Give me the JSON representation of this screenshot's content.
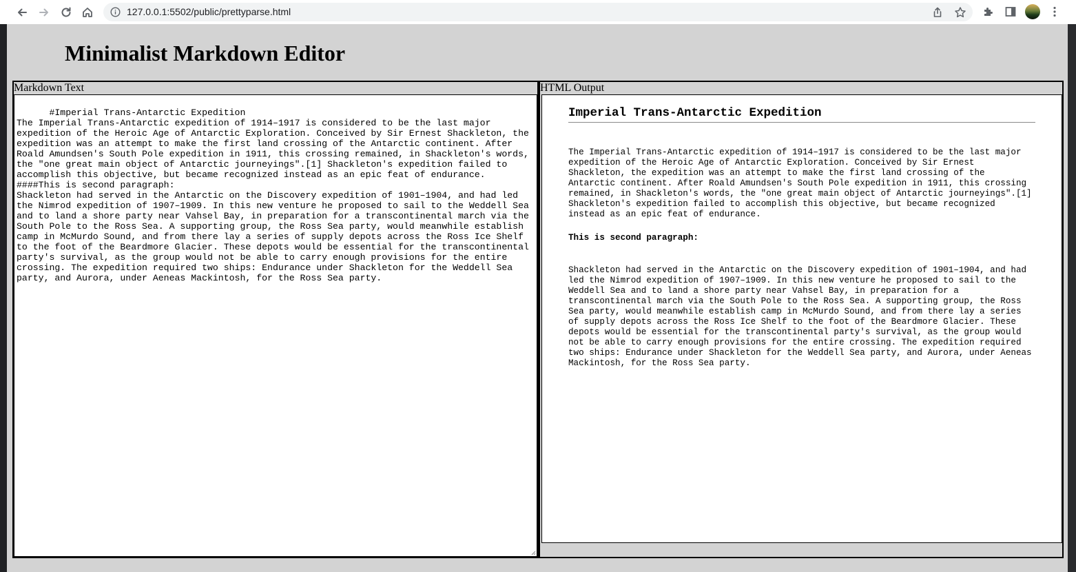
{
  "browser": {
    "url": "127.0.0.1:5502/public/prettyparse.html",
    "icons": [
      "back-icon",
      "forward-icon",
      "reload-icon",
      "home-icon",
      "info-icon",
      "share-icon",
      "star-icon",
      "extensions-icon",
      "side-panel-icon",
      "avatar",
      "menu-icon"
    ]
  },
  "page": {
    "title": "Minimalist Markdown Editor"
  },
  "editor": {
    "label": "Markdown Text",
    "value": "#Imperial Trans-Antarctic Expedition\nThe Imperial Trans-Antarctic expedition of 1914–1917 is considered to be the last major expedition of the Heroic Age of Antarctic Exploration. Conceived by Sir Ernest Shackleton, the expedition was an attempt to make the first land crossing of the Antarctic continent. After Roald Amundsen's South Pole expedition in 1911, this crossing remained, in Shackleton's words, the \"one great main object of Antarctic journeyings\".[1] Shackleton's expedition failed to accomplish this objective, but became recognized instead as an epic feat of endurance.\n####This is second paragraph:\nShackleton had served in the Antarctic on the Discovery expedition of 1901–1904, and had led the Nimrod expedition of 1907–1909. In this new venture he proposed to sail to the Weddell Sea and to land a shore party near Vahsel Bay, in preparation for a transcontinental march via the South Pole to the Ross Sea. A supporting group, the Ross Sea party, would meanwhile establish camp in McMurdo Sound, and from there lay a series of supply depots across the Ross Ice Shelf to the foot of the Beardmore Glacier. These depots would be essential for the transcontinental party's survival, as the group would not be able to carry enough provisions for the entire crossing. The expedition required two ships: Endurance under Shackleton for the Weddell Sea party, and Aurora, under Aeneas Mackintosh, for the Ross Sea party."
  },
  "output": {
    "label": "HTML Output",
    "heading": "Imperial Trans-Antarctic Expedition",
    "paragraph1": "The Imperial Trans-Antarctic expedition of 1914–1917 is considered to be the last major expedition of the Heroic Age of Antarctic Exploration. Conceived by Sir Ernest Shackleton, the expedition was an attempt to make the first land crossing of the Antarctic continent. After Roald Amundsen's South Pole expedition in 1911, this crossing remained, in Shackleton's words, the \"one great main object of Antarctic journeyings\".[1] Shackleton's expedition failed to accomplish this objective, but became recognized instead as an epic feat of endurance.",
    "subheading": "This is second paragraph:",
    "paragraph2": "Shackleton had served in the Antarctic on the Discovery expedition of 1901–1904, and had led the Nimrod expedition of 1907–1909. In this new venture he proposed to sail to the Weddell Sea and to land a shore party near Vahsel Bay, in preparation for a transcontinental march via the South Pole to the Ross Sea. A supporting group, the Ross Sea party, would meanwhile establish camp in McMurdo Sound, and from there lay a series of supply depots across the Ross Ice Shelf to the foot of the Beardmore Glacier. These depots would be essential for the transcontinental party's survival, as the group would not be able to carry enough provisions for the entire crossing. The expedition required two ships: Endurance under Shackleton for the Weddell Sea party, and Aurora, under Aeneas Mackintosh, for the Ross Sea party."
  },
  "colors": {
    "page_background": "#d3d3d3",
    "pane_border": "#000000",
    "content_background": "#ffffff"
  }
}
